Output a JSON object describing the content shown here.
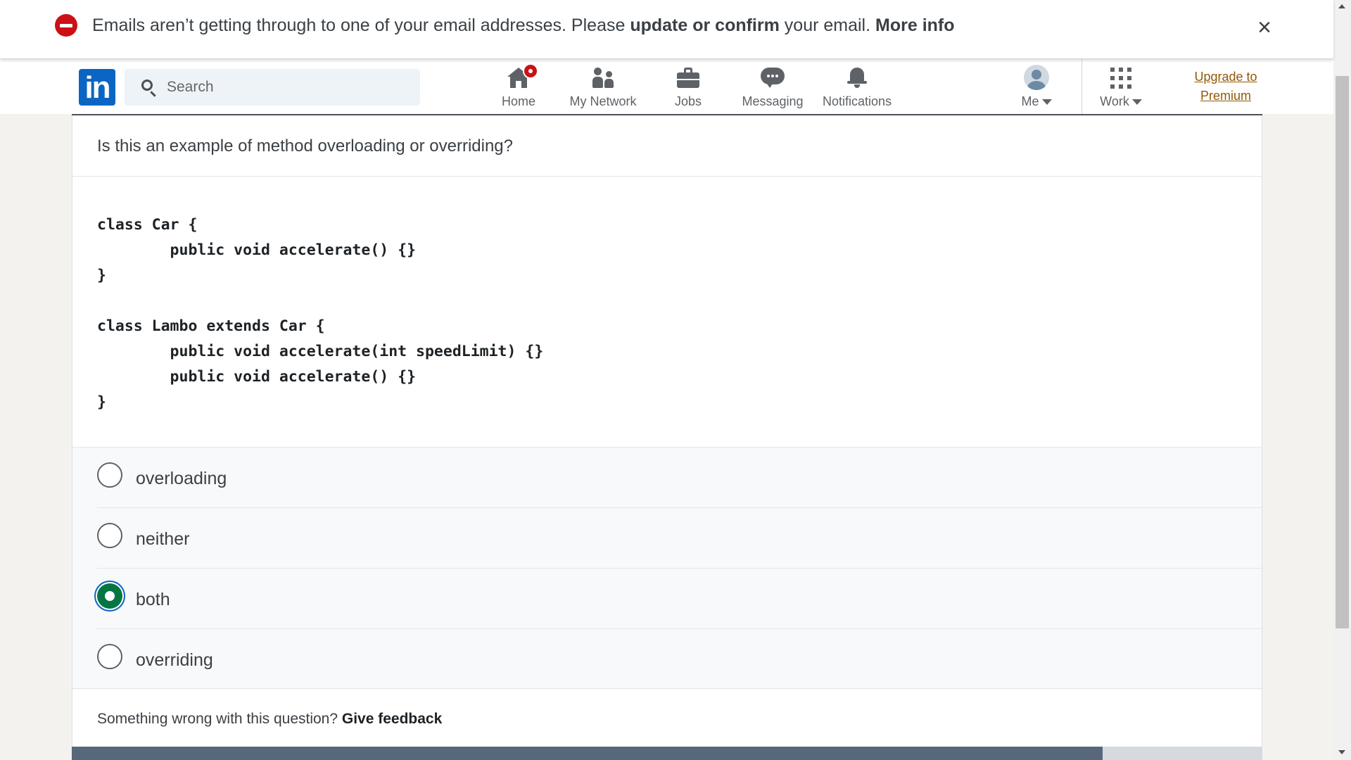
{
  "alert": {
    "text_before": "Emails aren’t getting through to one of your email addresses. Please ",
    "link_update": "update or confirm",
    "text_middle": " your email. ",
    "link_more": "More info",
    "close": "×"
  },
  "nav": {
    "logo": "in",
    "search_placeholder": "Search",
    "items": {
      "home": "Home",
      "network": "My Network",
      "jobs": "Jobs",
      "messaging": "Messaging",
      "notifications": "Notifications",
      "me": "Me",
      "work": "Work"
    },
    "premium_line1": "Upgrade to",
    "premium_line2": "Premium"
  },
  "quiz": {
    "question": "Is this an example of method overloading or overriding?",
    "code": "class Car {\n        public void accelerate() {}\n}\n\nclass Lambo extends Car {\n        public void accelerate(int speedLimit) {}\n        public void accelerate() {}\n}",
    "options": [
      {
        "label": "overloading",
        "selected": false
      },
      {
        "label": "neither",
        "selected": false
      },
      {
        "label": "both",
        "selected": true
      },
      {
        "label": "overriding",
        "selected": false
      }
    ],
    "feedback_prompt": "Something wrong with this question? ",
    "feedback_link": "Give feedback",
    "progress_fraction": 0.866
  },
  "colors": {
    "brand": "#0a66c2",
    "alert": "#cc1016",
    "selected": "#057642",
    "premium": "#915907"
  }
}
